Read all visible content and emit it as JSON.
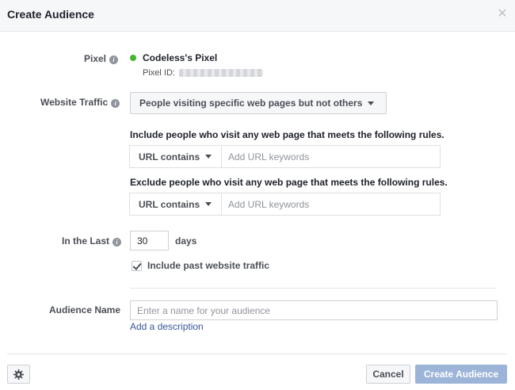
{
  "dialog": {
    "title": "Create Audience",
    "close_icon": "close-icon"
  },
  "pixel": {
    "label": "Pixel",
    "status_color": "#42b72a",
    "name": "Codeless's Pixel",
    "id_label": "Pixel ID:"
  },
  "website_traffic": {
    "label": "Website Traffic",
    "selected": "People visiting specific web pages but not others"
  },
  "include_rule": {
    "text": "Include people who visit any web page that meets the following rules.",
    "operator": "URL contains",
    "placeholder": "Add URL keywords"
  },
  "exclude_rule": {
    "text": "Exclude people who visit any web page that meets the following rules.",
    "operator": "URL contains",
    "placeholder": "Add URL keywords"
  },
  "in_the_last": {
    "label": "In the Last",
    "value": "30",
    "unit": "days"
  },
  "past_traffic": {
    "label": "Include past website traffic",
    "checked": true
  },
  "audience_name": {
    "label": "Audience Name",
    "placeholder": "Enter a name for your audience",
    "add_description": "Add a description"
  },
  "footer": {
    "settings_icon": "gear-icon",
    "cancel_label": "Cancel",
    "create_label": "Create Audience",
    "create_color": "#9cb4d8"
  }
}
